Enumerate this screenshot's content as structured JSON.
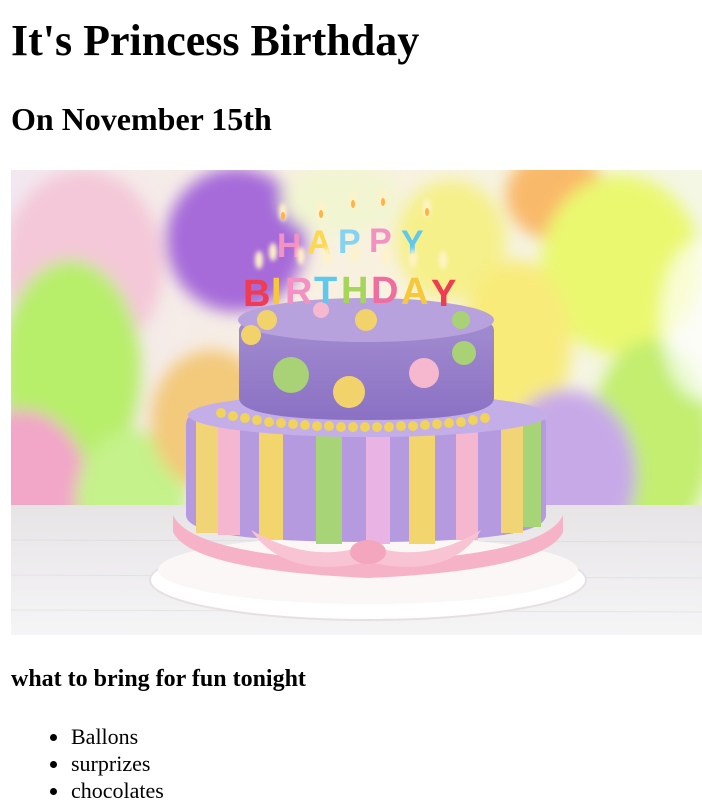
{
  "page": {
    "title": "It's Princess Birthday",
    "subtitle": "On November 15th"
  },
  "hero_image": {
    "description_icon": "birthday-cake-photo",
    "candle_text_top": "HAPPY",
    "candle_text_bottom": "BIRTHDAY"
  },
  "list_section": {
    "heading": "what to bring for fun tonight",
    "items": [
      "Ballons",
      "surprizes",
      "chocolates"
    ]
  },
  "colors": {
    "text": "#000000",
    "background": "#ffffff"
  }
}
